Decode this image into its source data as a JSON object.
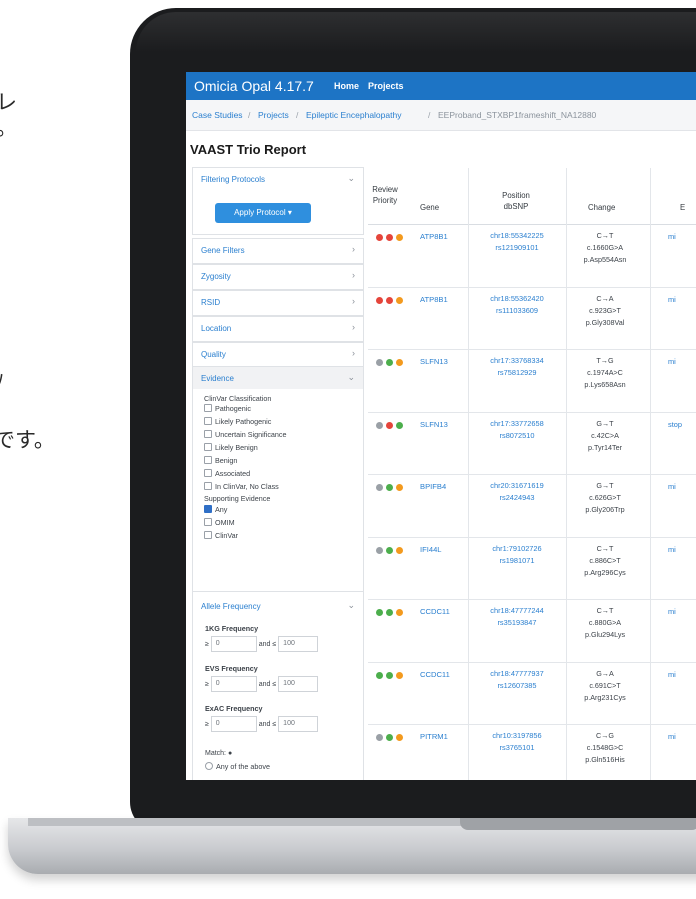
{
  "page_text": {
    "line1": "レ",
    "line2": "。",
    "line3": "ﾉ",
    "line4": "です。"
  },
  "colors": {
    "accent": "#1d74c5",
    "link": "#2a7fcf",
    "priority_red": "#e5453b",
    "priority_orange": "#f39a1e",
    "priority_green": "#4cae4c",
    "priority_gray": "#9aa0a6"
  },
  "app": {
    "brand": "Omicia Opal 4.17.7",
    "nav": [
      "Home",
      "Projects"
    ],
    "breadcrumb": [
      "Case Studies",
      "Projects",
      "Epileptic Encephalopathy",
      "EEProband_STXBP1frameshift_NA12880"
    ],
    "breadcrumb_sep": "/",
    "report_title": "VAAST Trio Report"
  },
  "sidebar": {
    "filtering_protocols": "Filtering Protocols",
    "apply_button": "Apply Protocol ▾",
    "panels": [
      "Gene Filters",
      "Zygosity",
      "RSID",
      "Location",
      "Quality"
    ],
    "evidence": {
      "label": "Evidence",
      "clinvar_heading": "ClinVar Classification",
      "clinvar_options": [
        "Pathogenic",
        "Likely Pathogenic",
        "Uncertain Significance",
        "Likely Benign",
        "Benign",
        "Associated",
        "In ClinVar, No Class"
      ],
      "supporting_heading": "Supporting Evidence",
      "supporting_options": [
        {
          "label": "Any",
          "checked": true
        },
        {
          "label": "OMIM",
          "checked": false
        },
        {
          "label": "ClinVar",
          "checked": false
        }
      ]
    },
    "allele_frequency": {
      "label": "Allele Frequency",
      "freqs": [
        {
          "label": "1KG Frequency",
          "min": "0",
          "max": "100"
        },
        {
          "label": "EVS Frequency",
          "min": "0",
          "max": "100"
        },
        {
          "label": "ExAC Frequency",
          "min": "0",
          "max": "100"
        }
      ],
      "ge": "≥",
      "and_le": "and ≤",
      "match_label": "Match:",
      "match_option": "Any of the above"
    },
    "chevrons": {
      "open": "⌄",
      "closed": "›"
    }
  },
  "table": {
    "headers": {
      "review_priority": "Review Priority",
      "gene": "Gene",
      "position_dbsnp": "Position dbSNP",
      "change": "Change",
      "effect": "E"
    },
    "rows": [
      {
        "dots": [
          "red",
          "red",
          "orange"
        ],
        "gene": "ATP8B1",
        "position": "chr18:55342225",
        "dbsnp": "rs121909101",
        "change": [
          "C→T",
          "c.1660G>A",
          "p.Asp554Asn"
        ],
        "effect": "mi"
      },
      {
        "dots": [
          "red",
          "red",
          "orange"
        ],
        "gene": "ATP8B1",
        "position": "chr18:55362420",
        "dbsnp": "rs111033609",
        "change": [
          "C→A",
          "c.923G>T",
          "p.Gly308Val"
        ],
        "effect": "mi"
      },
      {
        "dots": [
          "gray",
          "green",
          "orange"
        ],
        "gene": "SLFN13",
        "position": "chr17:33768334",
        "dbsnp": "rs75812929",
        "change": [
          "T→G",
          "c.1974A>C",
          "p.Lys658Asn"
        ],
        "effect": "mi"
      },
      {
        "dots": [
          "gray",
          "red",
          "green"
        ],
        "gene": "SLFN13",
        "position": "chr17:33772658",
        "dbsnp": "rs8072510",
        "change": [
          "G→T",
          "c.42C>A",
          "p.Tyr14Ter"
        ],
        "effect": "stop"
      },
      {
        "dots": [
          "gray",
          "green",
          "orange"
        ],
        "gene": "BPIFB4",
        "position": "chr20:31671619",
        "dbsnp": "rs2424943",
        "change": [
          "G→T",
          "c.626G>T",
          "p.Gly206Trp"
        ],
        "effect": "mi"
      },
      {
        "dots": [
          "gray",
          "green",
          "orange"
        ],
        "gene": "IFI44L",
        "position": "chr1:79102726",
        "dbsnp": "rs1981071",
        "change": [
          "C→T",
          "c.886C>T",
          "p.Arg296Cys"
        ],
        "effect": "mi"
      },
      {
        "dots": [
          "green",
          "green",
          "orange"
        ],
        "gene": "CCDC11",
        "position": "chr18:47777244",
        "dbsnp": "rs35193847",
        "change": [
          "C→T",
          "c.880G>A",
          "p.Glu294Lys"
        ],
        "effect": "mi"
      },
      {
        "dots": [
          "green",
          "green",
          "orange"
        ],
        "gene": "CCDC11",
        "position": "chr18:47777937",
        "dbsnp": "rs12607385",
        "change": [
          "G→A",
          "c.691C>T",
          "p.Arg231Cys"
        ],
        "effect": "mi"
      },
      {
        "dots": [
          "gray",
          "green",
          "orange"
        ],
        "gene": "PITRM1",
        "position": "chr10:3197856",
        "dbsnp": "rs3765101",
        "change": [
          "C→G",
          "c.1548G>C",
          "p.Gln516His"
        ],
        "effect": "mi"
      }
    ]
  }
}
